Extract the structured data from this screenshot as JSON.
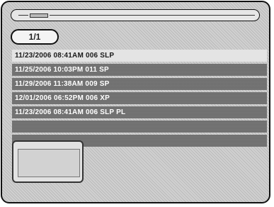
{
  "header": {
    "page_indicator": "1/1"
  },
  "recordings": [
    {
      "label": "11/23/2006 08:41AM 006 SLP",
      "selected": true
    },
    {
      "label": "11/25/2006 10:03PM 011 SP",
      "selected": false
    },
    {
      "label": "11/29/2006 11:38AM 009 SP",
      "selected": false
    },
    {
      "label": "12/01/2006 06:52PM 006 XP",
      "selected": false
    },
    {
      "label": "11/23/2006 08:41AM 006 SLP PL",
      "selected": false
    },
    {
      "label": "",
      "selected": false
    },
    {
      "label": "",
      "selected": false
    }
  ],
  "colors": {
    "selected_row": "#e4e4e4",
    "row": "#6e6e6e",
    "background": "#d0d0d0"
  }
}
